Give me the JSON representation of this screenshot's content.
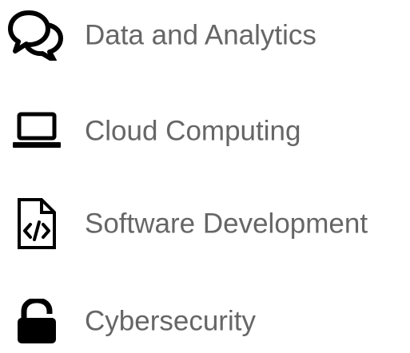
{
  "items": [
    {
      "label": "Data and Analytics",
      "icon": "chat-bubbles-icon"
    },
    {
      "label": "Cloud Computing",
      "icon": "laptop-icon"
    },
    {
      "label": "Software Development",
      "icon": "code-file-icon"
    },
    {
      "label": "Cybersecurity",
      "icon": "unlocked-padlock-icon"
    }
  ],
  "colors": {
    "icon": "#000000",
    "text": "#666666",
    "background": "#ffffff"
  }
}
